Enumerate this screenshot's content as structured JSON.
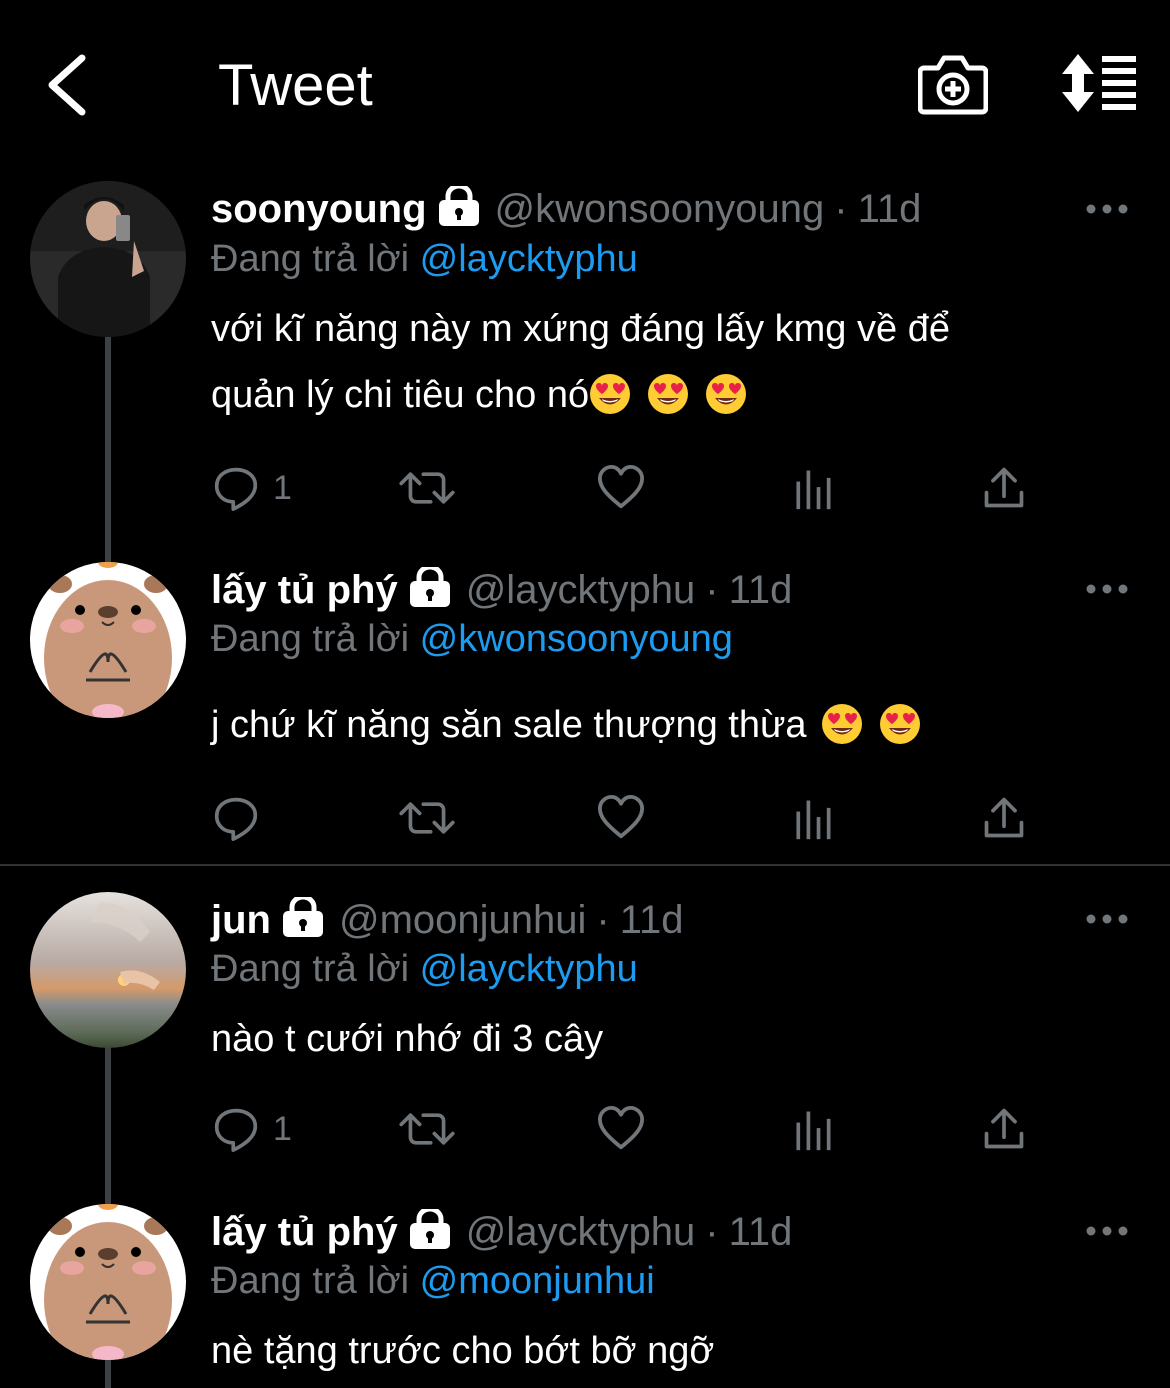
{
  "header": {
    "title": "Tweet",
    "back_icon": "chevron-left-icon",
    "camera_icon": "camera-plus-icon",
    "sort_icon": "sort-list-icon"
  },
  "colors": {
    "background": "#000000",
    "text": "#ffffff",
    "secondary": "#71767b",
    "link": "#1d9bf0",
    "divider": "#2f3336",
    "thread_line": "#3d4144"
  },
  "tweets": [
    {
      "name": "soonyoung",
      "handle": "@kwonsoonyoung",
      "sep": "·",
      "time": "11d",
      "reply_prefix": "Đang trả lời",
      "reply_to": "@laycktyphu",
      "text_line1": "với kĩ năng này m xứng đáng lấy kmg về để",
      "text_line2": "quản lý chi tiêu cho nó",
      "emojis": [
        "heart-eyes",
        "heart-eyes",
        "heart-eyes"
      ],
      "reply_count": "1"
    },
    {
      "name": "lấy tủ phý",
      "handle": "@laycktyphu",
      "sep": "·",
      "time": "11d",
      "reply_prefix": "Đang trả lời",
      "reply_to": "@kwonsoonyoung",
      "text_line1": "j chứ kĩ năng săn sale thượng thừa",
      "emojis": [
        "heart-eyes",
        "heart-eyes"
      ],
      "reply_count": ""
    },
    {
      "name": "jun",
      "handle": "@moonjunhui",
      "sep": "·",
      "time": "11d",
      "reply_prefix": "Đang trả lời",
      "reply_to": "@laycktyphu",
      "text_line1": "nào t cưới nhớ đi 3 cây",
      "reply_count": "1"
    },
    {
      "name": "lấy tủ phý",
      "handle": "@laycktyphu",
      "sep": "·",
      "time": "11d",
      "reply_prefix": "Đang trả lời",
      "reply_to": "@moonjunhui",
      "text_line1": "nè tặng trước cho bớt bỡ ngỡ"
    }
  ]
}
